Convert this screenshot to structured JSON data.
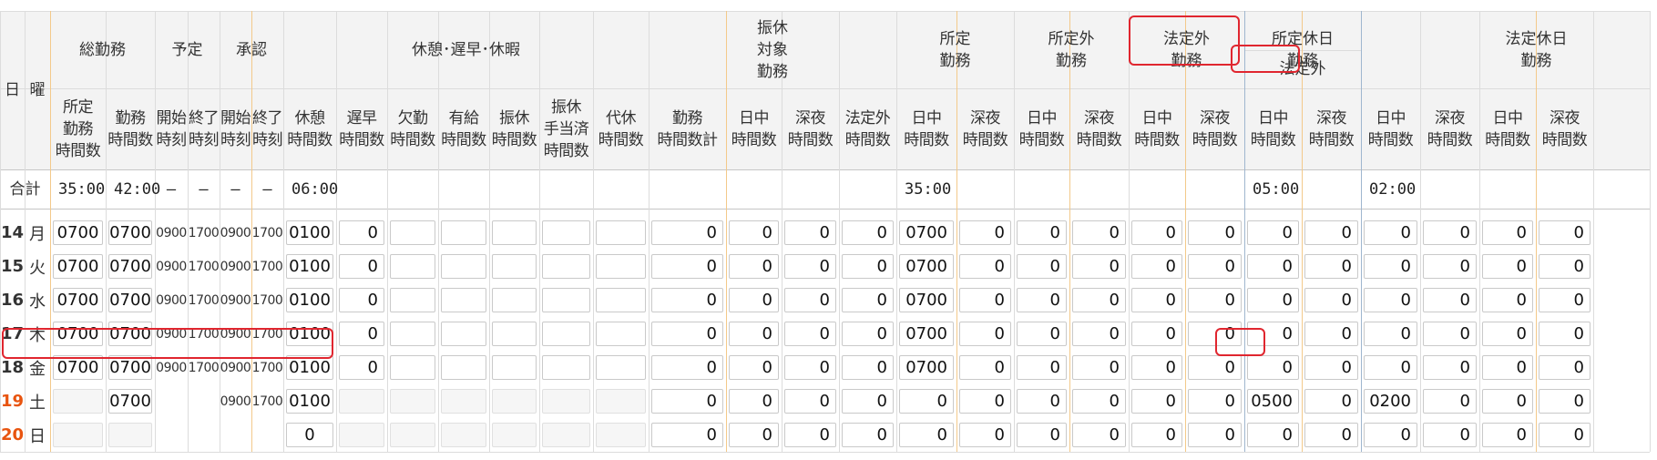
{
  "header": {
    "day": "日",
    "dow": "曜",
    "groups": {
      "total_work": "総勤務",
      "planned": "予定",
      "approved": "承認",
      "break_leave": "休憩･遅早･休暇",
      "substitute_work": "振休\n対象\n勤務",
      "scheduled_work": "所定\n勤務",
      "non_scheduled_work": "所定外\n勤務",
      "statutory_overtime": "法定外\n勤務",
      "scheduled_holiday_work": "所定休日\n勤務",
      "non_statutory": "法定外",
      "statutory_holiday_work": "法定休日\n勤務"
    },
    "columns": [
      "所定\n勤務\n時間数",
      "勤務\n時間数",
      "開始\n時刻",
      "終了\n時刻",
      "開始\n時刻",
      "終了\n時刻",
      "休憩\n時間数",
      "遅早\n時間数",
      "欠勤\n時間数",
      "有給\n時間数",
      "振休\n時間数",
      "振休\n手当済\n時間数",
      "代休\n時間数",
      "勤務\n時間数計",
      "日中\n時間数",
      "深夜\n時間数",
      "法定外\n時間数",
      "日中\n時間数",
      "深夜\n時間数",
      "日中\n時間数",
      "深夜\n時間数",
      "日中\n時間数",
      "深夜\n時間数",
      "日中\n時間数",
      "深夜\n時間数",
      "日中\n時間数",
      "深夜\n時間数",
      "日中\n時間数",
      "深夜\n時間数"
    ]
  },
  "totals": {
    "label": "合計",
    "values": [
      "35:00",
      "42:00",
      "–",
      "–",
      "–",
      "–",
      "06:00",
      "",
      "",
      "",
      "",
      "",
      "",
      "",
      "",
      "",
      "",
      "35:00",
      "",
      "",
      "",
      "",
      "",
      "05:00",
      "",
      "02:00",
      "",
      "",
      ""
    ]
  },
  "rows": [
    {
      "day": "14",
      "dow": "月",
      "weekend": false,
      "values": [
        "0700",
        "0700",
        "0900",
        "1700",
        "0900",
        "1700",
        "0100",
        "0",
        "",
        "",
        "",
        "",
        "",
        "0",
        "0",
        "0",
        "0",
        "0700",
        "0",
        "0",
        "0",
        "0",
        "0",
        "0",
        "0",
        "0",
        "0",
        "0",
        "0"
      ]
    },
    {
      "day": "15",
      "dow": "火",
      "weekend": false,
      "values": [
        "0700",
        "0700",
        "0900",
        "1700",
        "0900",
        "1700",
        "0100",
        "0",
        "",
        "",
        "",
        "",
        "",
        "0",
        "0",
        "0",
        "0",
        "0700",
        "0",
        "0",
        "0",
        "0",
        "0",
        "0",
        "0",
        "0",
        "0",
        "0",
        "0"
      ]
    },
    {
      "day": "16",
      "dow": "水",
      "weekend": false,
      "values": [
        "0700",
        "0700",
        "0900",
        "1700",
        "0900",
        "1700",
        "0100",
        "0",
        "",
        "",
        "",
        "",
        "",
        "0",
        "0",
        "0",
        "0",
        "0700",
        "0",
        "0",
        "0",
        "0",
        "0",
        "0",
        "0",
        "0",
        "0",
        "0",
        "0"
      ]
    },
    {
      "day": "17",
      "dow": "木",
      "weekend": false,
      "values": [
        "0700",
        "0700",
        "0900",
        "1700",
        "0900",
        "1700",
        "0100",
        "0",
        "",
        "",
        "",
        "",
        "",
        "0",
        "0",
        "0",
        "0",
        "0700",
        "0",
        "0",
        "0",
        "0",
        "0",
        "0",
        "0",
        "0",
        "0",
        "0",
        "0"
      ]
    },
    {
      "day": "18",
      "dow": "金",
      "weekend": false,
      "values": [
        "0700",
        "0700",
        "0900",
        "1700",
        "0900",
        "1700",
        "0100",
        "0",
        "",
        "",
        "",
        "",
        "",
        "0",
        "0",
        "0",
        "0",
        "0700",
        "0",
        "0",
        "0",
        "0",
        "0",
        "0",
        "0",
        "0",
        "0",
        "0",
        "0"
      ]
    },
    {
      "day": "19",
      "dow": "土",
      "weekend": true,
      "values": [
        "",
        "0700",
        "",
        "",
        "0900",
        "1700",
        "0100",
        "",
        "",
        "",
        "",
        "",
        "",
        "0",
        "0",
        "0",
        "0",
        "0",
        "0",
        "0",
        "0",
        "0",
        "0",
        "0500",
        "0",
        "0200",
        "0",
        "0",
        "0"
      ]
    },
    {
      "day": "20",
      "dow": "日",
      "weekend": true,
      "values": [
        "",
        "",
        "",
        "",
        "",
        "",
        "0",
        "",
        "",
        "",
        "",
        "",
        "",
        "0",
        "0",
        "0",
        "0",
        "0",
        "0",
        "0",
        "0",
        "0",
        "0",
        "0",
        "0",
        "0",
        "0",
        "0",
        "0"
      ]
    }
  ]
}
